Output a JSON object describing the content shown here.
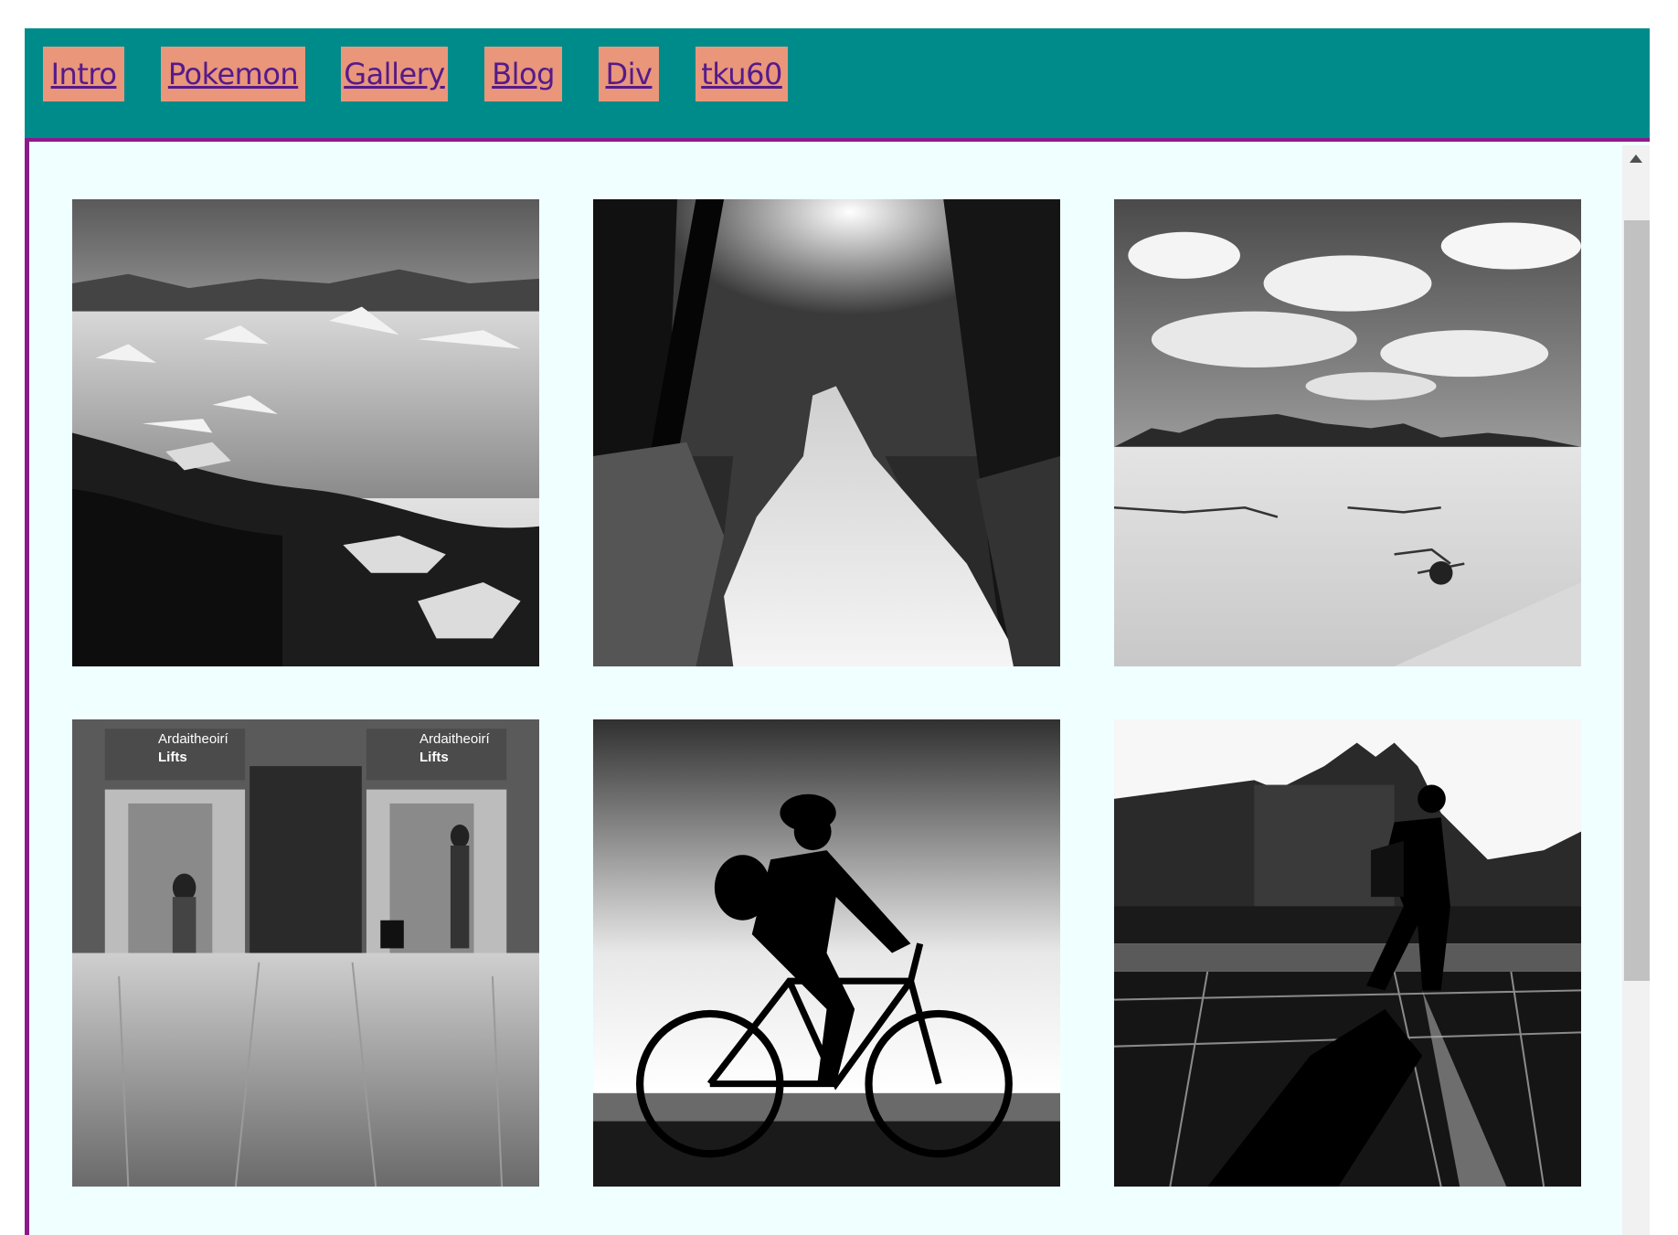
{
  "nav": {
    "items": [
      {
        "label": "Intro"
      },
      {
        "label": "Pokemon"
      },
      {
        "label": "Gallery"
      },
      {
        "label": "Blog"
      },
      {
        "label": "Div"
      },
      {
        "label": "tku60"
      }
    ]
  },
  "colors": {
    "navbar": "#008b8b",
    "nav_item": "#e9967a",
    "link": "#551a8b",
    "content_bg": "#f0ffff",
    "content_border": "#8b1a8b"
  },
  "gallery": {
    "photos": [
      {
        "subject": "icebergs on a lake shore"
      },
      {
        "subject": "forest waterfall"
      },
      {
        "subject": "desert dunes and mountains"
      },
      {
        "subject": "airport lifts with travellers",
        "sign_text": "Ardaitheoirí",
        "sign_subtext": "Lifts"
      },
      {
        "subject": "cyclist silhouette"
      },
      {
        "subject": "man walking in city silhouette"
      }
    ]
  }
}
